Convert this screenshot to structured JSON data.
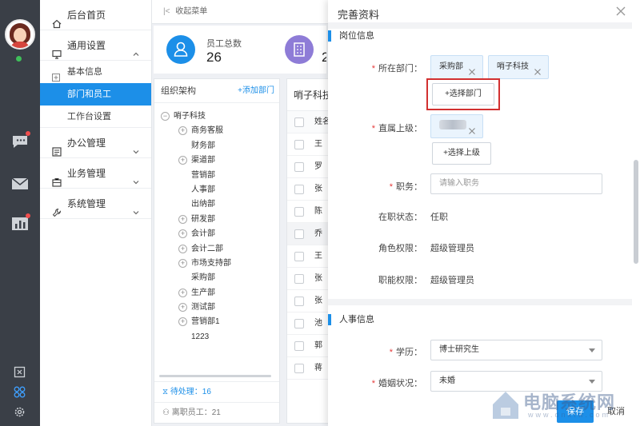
{
  "rail": {
    "icons": [
      "avatar",
      "chat-icon",
      "mail-icon",
      "chart-icon",
      "screen-icon",
      "apps-icon",
      "settings-icon"
    ]
  },
  "menu": {
    "home": "后台首页",
    "general": "通用设置",
    "sub": [
      "基本信息",
      "部门和员工",
      "工作台设置"
    ],
    "office": "办公管理",
    "business": "业务管理",
    "system": "系统管理"
  },
  "topbar": {
    "collapse": "收起菜单"
  },
  "stats": {
    "label": "员工总数",
    "value": "26",
    "second_value": "2"
  },
  "org": {
    "title": "组织架构",
    "add": "+添加部门",
    "root": "哨子科技",
    "nodes": [
      "商务客服",
      "财务部",
      "渠道部",
      "营销部",
      "人事部",
      "出纳部",
      "研发部",
      "会计部",
      "会计二部",
      "市场支持部",
      "采购部",
      "生产部",
      "测试部",
      "营销部1",
      "1223"
    ],
    "pending": "待处理：16",
    "left": "离职员工：21"
  },
  "emp": {
    "title": "哨子科技",
    "header": "姓名",
    "names": [
      "王",
      "罗",
      "张",
      "陈",
      "乔",
      "王",
      "张",
      "张",
      "池",
      "郭",
      "蒋"
    ]
  },
  "drawer": {
    "title": "完善资料",
    "sec1": "岗位信息",
    "dept_label": "所在部门：",
    "dept_tags": [
      "采购部",
      "哨子科技"
    ],
    "choose_dept": "+选择部门",
    "leader_label": "直属上级：",
    "choose_leader": "+选择上级",
    "position_label": "职务：",
    "position_placeholder": "请输入职务",
    "status_label": "在职状态：",
    "status_value": "任职",
    "role_label": "角色权限：",
    "role_value": "超级管理员",
    "func_label": "职能权限：",
    "func_value": "超级管理员",
    "sec2": "人事信息",
    "edu_label": "学历：",
    "edu_value": "博士研究生",
    "marriage_label": "婚姻状况：",
    "marriage_value": "未婚",
    "save": "保存",
    "cancel": "取消"
  },
  "watermark": {
    "text": "电脑系统网",
    "sub": "www.dnxtw.com"
  },
  "colors": {
    "accent": "#1c8fe8",
    "rail": "#3a3f47",
    "highlight": "#d23030"
  }
}
